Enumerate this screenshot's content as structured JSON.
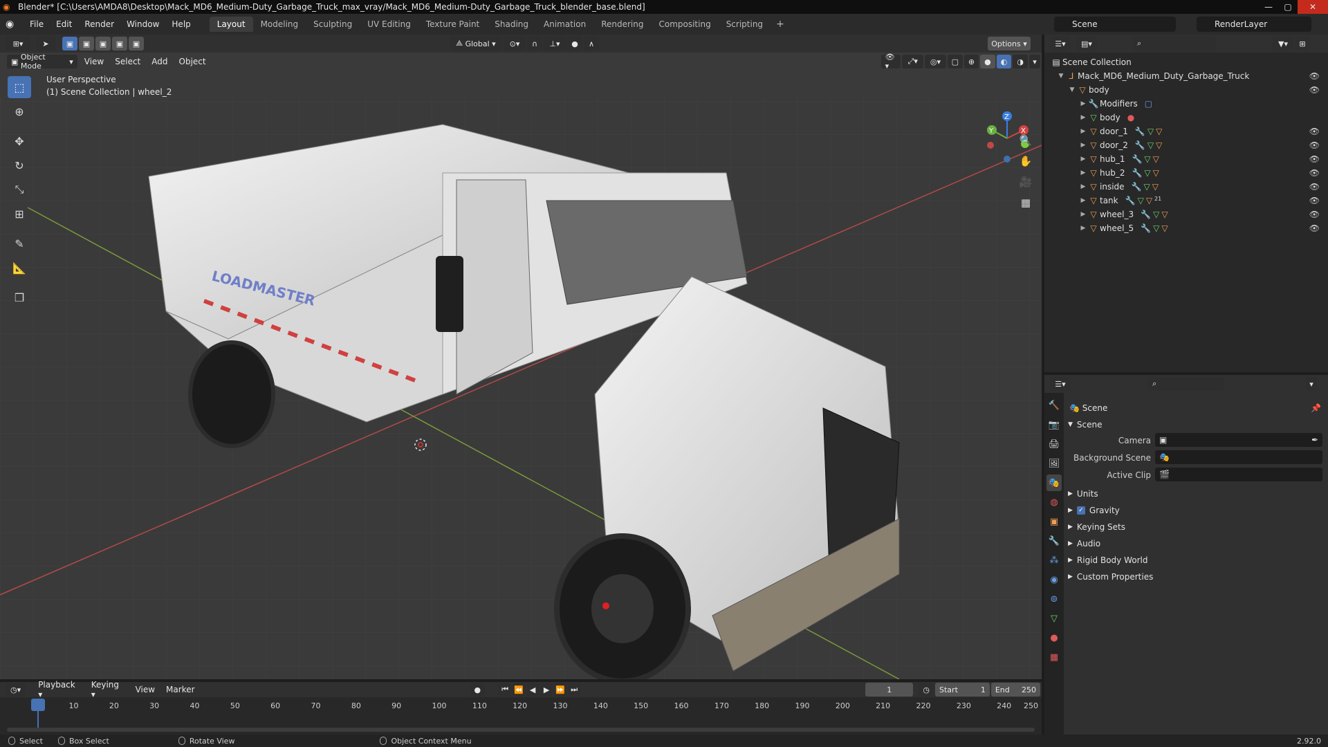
{
  "titlebar": {
    "title": "Blender* [C:\\Users\\AMDA8\\Desktop\\Mack_MD6_Medium-Duty_Garbage_Truck_max_vray/Mack_MD6_Medium-Duty_Garbage_Truck_blender_base.blend]",
    "minimize": "—",
    "maximize": "▢",
    "close": "✕"
  },
  "menubar": {
    "items": [
      "File",
      "Edit",
      "Render",
      "Window",
      "Help"
    ],
    "workspaces": [
      "Layout",
      "Modeling",
      "Sculpting",
      "UV Editing",
      "Texture Paint",
      "Shading",
      "Animation",
      "Rendering",
      "Compositing",
      "Scripting"
    ],
    "plus": "+",
    "scene": "Scene",
    "render_layer": "RenderLayer"
  },
  "viewport": {
    "transform_orientation": "Global",
    "options": "Options",
    "mode": "Object Mode",
    "menus": [
      "View",
      "Select",
      "Add",
      "Object"
    ],
    "info_line1": "User Perspective",
    "info_line2": "(1) Scene Collection | wheel_2",
    "truck_logo": "LOADMASTER",
    "gizmo": {
      "x": "X",
      "y": "Y",
      "z": "Z"
    }
  },
  "outliner": {
    "root": "Scene Collection",
    "collection": "Mack_MD6_Medium_Duty_Garbage_Truck",
    "items": [
      {
        "name": "body",
        "level": 2
      },
      {
        "name": "Modifiers",
        "level": 3
      },
      {
        "name": "body",
        "level": 3
      },
      {
        "name": "door_1",
        "level": 3
      },
      {
        "name": "door_2",
        "level": 3
      },
      {
        "name": "hub_1",
        "level": 3
      },
      {
        "name": "hub_2",
        "level": 3
      },
      {
        "name": "inside",
        "level": 3
      },
      {
        "name": "tank",
        "level": 3
      },
      {
        "name": "wheel_3",
        "level": 3
      },
      {
        "name": "wheel_5",
        "level": 3
      }
    ],
    "tank_badge": "21"
  },
  "properties": {
    "header": "Scene",
    "panel": "Scene",
    "camera_label": "Camera",
    "background_scene_label": "Background Scene",
    "active_clip_label": "Active Clip",
    "sections": [
      "Units",
      "Gravity",
      "Keying Sets",
      "Audio",
      "Rigid Body World",
      "Custom Properties"
    ],
    "gravity_checked": true
  },
  "timeline": {
    "menus": [
      "Playback",
      "Keying",
      "View",
      "Marker"
    ],
    "current_frame": "1",
    "start_label": "Start",
    "start": "1",
    "end_label": "End",
    "end": "250",
    "ticks": [
      "1",
      "10",
      "20",
      "30",
      "40",
      "50",
      "60",
      "70",
      "80",
      "90",
      "100",
      "110",
      "120",
      "130",
      "140",
      "150",
      "160",
      "170",
      "180",
      "190",
      "200",
      "210",
      "220",
      "230",
      "240",
      "250"
    ]
  },
  "statusbar": {
    "select": "Select",
    "box_select": "Box Select",
    "rotate_view": "Rotate View",
    "context_menu": "Object Context Menu",
    "version": "2.92.0"
  }
}
